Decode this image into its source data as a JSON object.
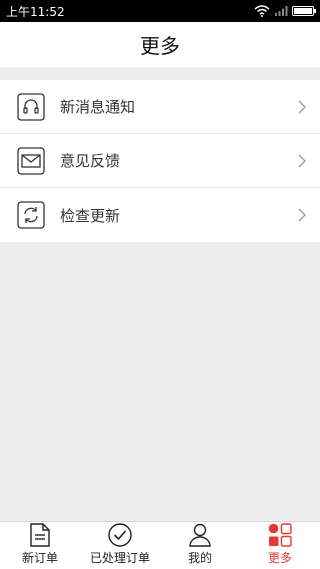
{
  "status_bar": {
    "time": "上午11:52"
  },
  "header": {
    "title": "更多"
  },
  "menu": [
    {
      "label": "新消息通知",
      "icon": "headphones-icon"
    },
    {
      "label": "意见反馈",
      "icon": "envelope-icon"
    },
    {
      "label": "检查更新",
      "icon": "refresh-icon"
    }
  ],
  "tabs": [
    {
      "label": "新订单",
      "icon": "document-icon"
    },
    {
      "label": "已处理订单",
      "icon": "check-circle-icon"
    },
    {
      "label": "我的",
      "icon": "person-icon"
    },
    {
      "label": "更多",
      "icon": "grid-icon",
      "active": true
    }
  ],
  "colors": {
    "accent": "#e53935",
    "background": "#eeeeee"
  },
  "battery_level": 1.0
}
